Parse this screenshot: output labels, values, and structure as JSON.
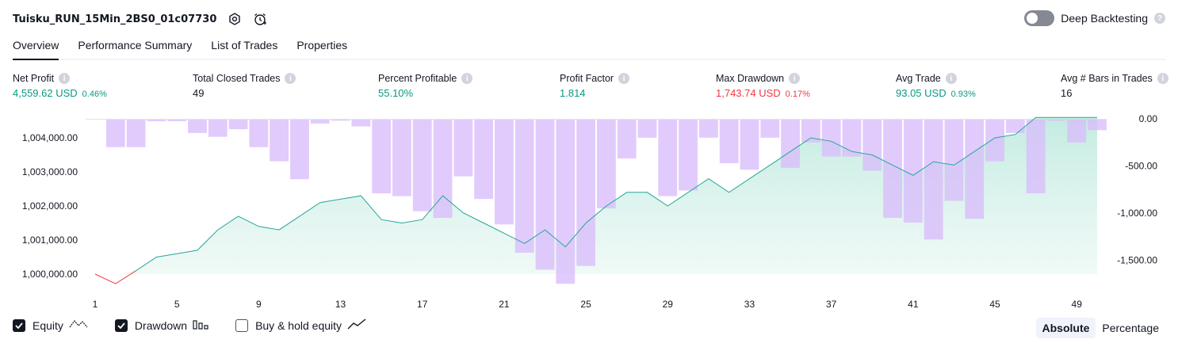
{
  "header": {
    "strategy_name": "Tuisku_RUN_15Min_2BS0_01c07730",
    "deep_backtesting_label": "Deep Backtesting"
  },
  "tabs": [
    {
      "label": "Overview",
      "active": true
    },
    {
      "label": "Performance Summary",
      "active": false
    },
    {
      "label": "List of Trades",
      "active": false
    },
    {
      "label": "Properties",
      "active": false
    }
  ],
  "metrics": [
    {
      "label": "Net Profit",
      "value": "4,559.62 USD",
      "pct": "0.46%",
      "color": "#089981"
    },
    {
      "label": "Total Closed Trades",
      "value": "49",
      "pct": "",
      "color": "#131722"
    },
    {
      "label": "Percent Profitable",
      "value": "55.10%",
      "pct": "",
      "color": "#089981"
    },
    {
      "label": "Profit Factor",
      "value": "1.814",
      "pct": "",
      "color": "#089981"
    },
    {
      "label": "Max Drawdown",
      "value": "1,743.74 USD",
      "pct": "0.17%",
      "color": "#f23645"
    },
    {
      "label": "Avg Trade",
      "value": "93.05 USD",
      "pct": "0.93%",
      "color": "#089981"
    },
    {
      "label": "Avg # Bars in Trades",
      "value": "16",
      "pct": "",
      "color": "#131722"
    }
  ],
  "legend": {
    "equity": "Equity",
    "drawdown": "Drawdown",
    "buy_hold": "Buy & hold equity"
  },
  "modes": {
    "absolute": "Absolute",
    "percentage": "Percentage"
  },
  "colors": {
    "equity_line": "#26a69a",
    "equity_negative_line": "#f23645",
    "drawdown_bar": "#d8bcfb",
    "grid_zero": "#e0e3eb"
  },
  "chart_data": {
    "type": "line",
    "x_ticks": [
      1,
      5,
      9,
      13,
      17,
      21,
      25,
      29,
      33,
      37,
      41,
      45,
      49
    ],
    "y_left_ticks": [
      "1,000,000.00",
      "1,001,000.00",
      "1,002,000.00",
      "1,003,000.00",
      "1,004,000.00"
    ],
    "y_left_tick_values": [
      1000000,
      1001000,
      1002000,
      1003000,
      1004000
    ],
    "y_left_range": [
      999700,
      1004600
    ],
    "y_right_ticks": [
      "0.00",
      "-500.00",
      "-1,000.00",
      "-1,500.00"
    ],
    "y_right_tick_values": [
      0,
      -500,
      -1000,
      -1500
    ],
    "y_right_range": [
      -1760,
      0
    ],
    "x_range": [
      1,
      50
    ],
    "series": [
      {
        "name": "Equity",
        "kind": "line",
        "x": [
          1,
          2,
          3,
          4,
          5,
          6,
          7,
          8,
          9,
          10,
          11,
          12,
          13,
          14,
          15,
          16,
          17,
          18,
          19,
          20,
          21,
          22,
          23,
          24,
          25,
          26,
          27,
          28,
          29,
          30,
          31,
          32,
          33,
          34,
          35,
          36,
          37,
          38,
          39,
          40,
          41,
          42,
          43,
          44,
          45,
          46,
          47,
          48,
          49,
          50
        ],
        "values": [
          1000000,
          999720,
          1000100,
          1000500,
          1000600,
          1000700,
          1001300,
          1001700,
          1001400,
          1001300,
          1001700,
          1002100,
          1002200,
          1002300,
          1001600,
          1001500,
          1001600,
          1002300,
          1001800,
          1001500,
          1001200,
          1000900,
          1001300,
          1000800,
          1001500,
          1002000,
          1002400,
          1002400,
          1002000,
          1002400,
          1002800,
          1002400,
          1002800,
          1003200,
          1003600,
          1004000,
          1003900,
          1003600,
          1003500,
          1003200,
          1002900,
          1003300,
          1003200,
          1003600,
          1004000,
          1004100,
          1004600,
          1004600,
          1004600,
          1004600
        ]
      },
      {
        "name": "Drawdown",
        "kind": "bar",
        "x": [
          1,
          2,
          3,
          4,
          5,
          6,
          7,
          8,
          9,
          10,
          11,
          12,
          13,
          14,
          15,
          16,
          17,
          18,
          19,
          20,
          21,
          22,
          23,
          24,
          25,
          26,
          27,
          28,
          29,
          30,
          31,
          32,
          33,
          34,
          35,
          36,
          37,
          38,
          39,
          40,
          41,
          42,
          43,
          44,
          45,
          46,
          47,
          48,
          49,
          50
        ],
        "values": [
          0,
          -300,
          -300,
          -25,
          -25,
          -150,
          -190,
          -110,
          -300,
          -450,
          -640,
          -50,
          -20,
          -80,
          -790,
          -820,
          -980,
          -1050,
          -610,
          -850,
          -1120,
          -1420,
          -1600,
          -1750,
          -1560,
          -950,
          -420,
          -200,
          -820,
          -760,
          -200,
          -470,
          -540,
          -200,
          -520,
          -250,
          -400,
          -400,
          -550,
          -1050,
          -1100,
          -1280,
          -870,
          -1060,
          -450,
          -150,
          -790,
          -20,
          -250,
          -120
        ]
      }
    ],
    "grid": false
  }
}
